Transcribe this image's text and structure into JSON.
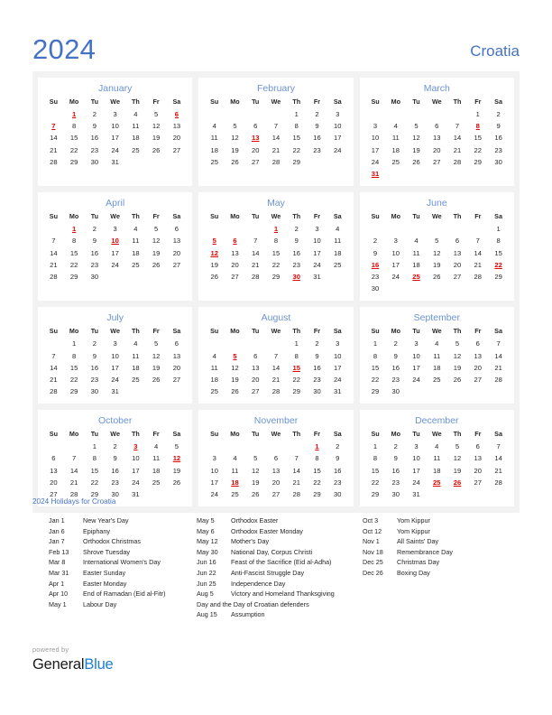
{
  "header": {
    "year": "2024",
    "country": "Croatia"
  },
  "weekday_headers": [
    "Su",
    "Mo",
    "Tu",
    "We",
    "Th",
    "Fr",
    "Sa"
  ],
  "months": [
    {
      "name": "January",
      "first_weekday": 1,
      "days": 31,
      "holidays": [
        1,
        6,
        7
      ]
    },
    {
      "name": "February",
      "first_weekday": 4,
      "days": 29,
      "holidays": [
        13
      ]
    },
    {
      "name": "March",
      "first_weekday": 5,
      "days": 31,
      "holidays": [
        8,
        31
      ]
    },
    {
      "name": "April",
      "first_weekday": 1,
      "days": 30,
      "holidays": [
        1,
        10
      ]
    },
    {
      "name": "May",
      "first_weekday": 3,
      "days": 31,
      "holidays": [
        1,
        5,
        6,
        12,
        30
      ]
    },
    {
      "name": "June",
      "first_weekday": 6,
      "days": 30,
      "holidays": [
        16,
        22,
        25
      ]
    },
    {
      "name": "July",
      "first_weekday": 1,
      "days": 31,
      "holidays": []
    },
    {
      "name": "August",
      "first_weekday": 4,
      "days": 31,
      "holidays": [
        5,
        15
      ]
    },
    {
      "name": "September",
      "first_weekday": 0,
      "days": 30,
      "holidays": []
    },
    {
      "name": "October",
      "first_weekday": 2,
      "days": 31,
      "holidays": [
        3,
        12
      ]
    },
    {
      "name": "November",
      "first_weekday": 5,
      "days": 30,
      "holidays": [
        1,
        18
      ]
    },
    {
      "name": "December",
      "first_weekday": 0,
      "days": 31,
      "holidays": [
        25,
        26
      ]
    }
  ],
  "holidays_section": {
    "title": "2024 Holidays for Croatia",
    "columns": [
      [
        {
          "date": "Jan 1",
          "name": "New Year's Day"
        },
        {
          "date": "Jan 6",
          "name": "Epiphany"
        },
        {
          "date": "Jan 7",
          "name": "Orthodox Christmas"
        },
        {
          "date": "Feb 13",
          "name": "Shrove Tuesday"
        },
        {
          "date": "Mar 8",
          "name": "International Women's Day"
        },
        {
          "date": "Mar 31",
          "name": "Easter Sunday"
        },
        {
          "date": "Apr 1",
          "name": "Easter Monday"
        },
        {
          "date": "Apr 10",
          "name": "End of Ramadan (Eid al-Fitr)"
        },
        {
          "date": "May 1",
          "name": "Labour Day"
        }
      ],
      [
        {
          "date": "May 5",
          "name": "Orthodox Easter"
        },
        {
          "date": "May 6",
          "name": "Orthodox Easter Monday"
        },
        {
          "date": "May 12",
          "name": "Mother's Day"
        },
        {
          "date": "May 30",
          "name": "National Day, Corpus Christi"
        },
        {
          "date": "Jun 16",
          "name": "Feast of the Sacrifice (Eid al-Adha)"
        },
        {
          "date": "Jun 22",
          "name": "Anti-Fascist Struggle Day"
        },
        {
          "date": "Jun 25",
          "name": "Independence Day"
        },
        {
          "date": "Aug 5",
          "name": "Victory and Homeland Thanksgiving",
          "continuation": "Day and the Day of Croatian defenders"
        },
        {
          "date": "Aug 15",
          "name": "Assumption"
        }
      ],
      [
        {
          "date": "Oct 3",
          "name": "Yom Kippur"
        },
        {
          "date": "Oct 12",
          "name": "Yom Kippur"
        },
        {
          "date": "Nov 1",
          "name": "All Saints' Day"
        },
        {
          "date": "Nov 18",
          "name": "Remembrance Day"
        },
        {
          "date": "Dec 25",
          "name": "Christmas Day"
        },
        {
          "date": "Dec 26",
          "name": "Boxing Day"
        }
      ]
    ]
  },
  "footer": {
    "powered_by": "powered by",
    "logo_first": "General",
    "logo_second": "Blue"
  },
  "colors": {
    "accent_blue": "#4472c4",
    "month_blue": "#6a93d4",
    "holiday_red": "#e00000",
    "panel_bg": "#f2f2f2",
    "logo_blue": "#1b7fd4"
  }
}
